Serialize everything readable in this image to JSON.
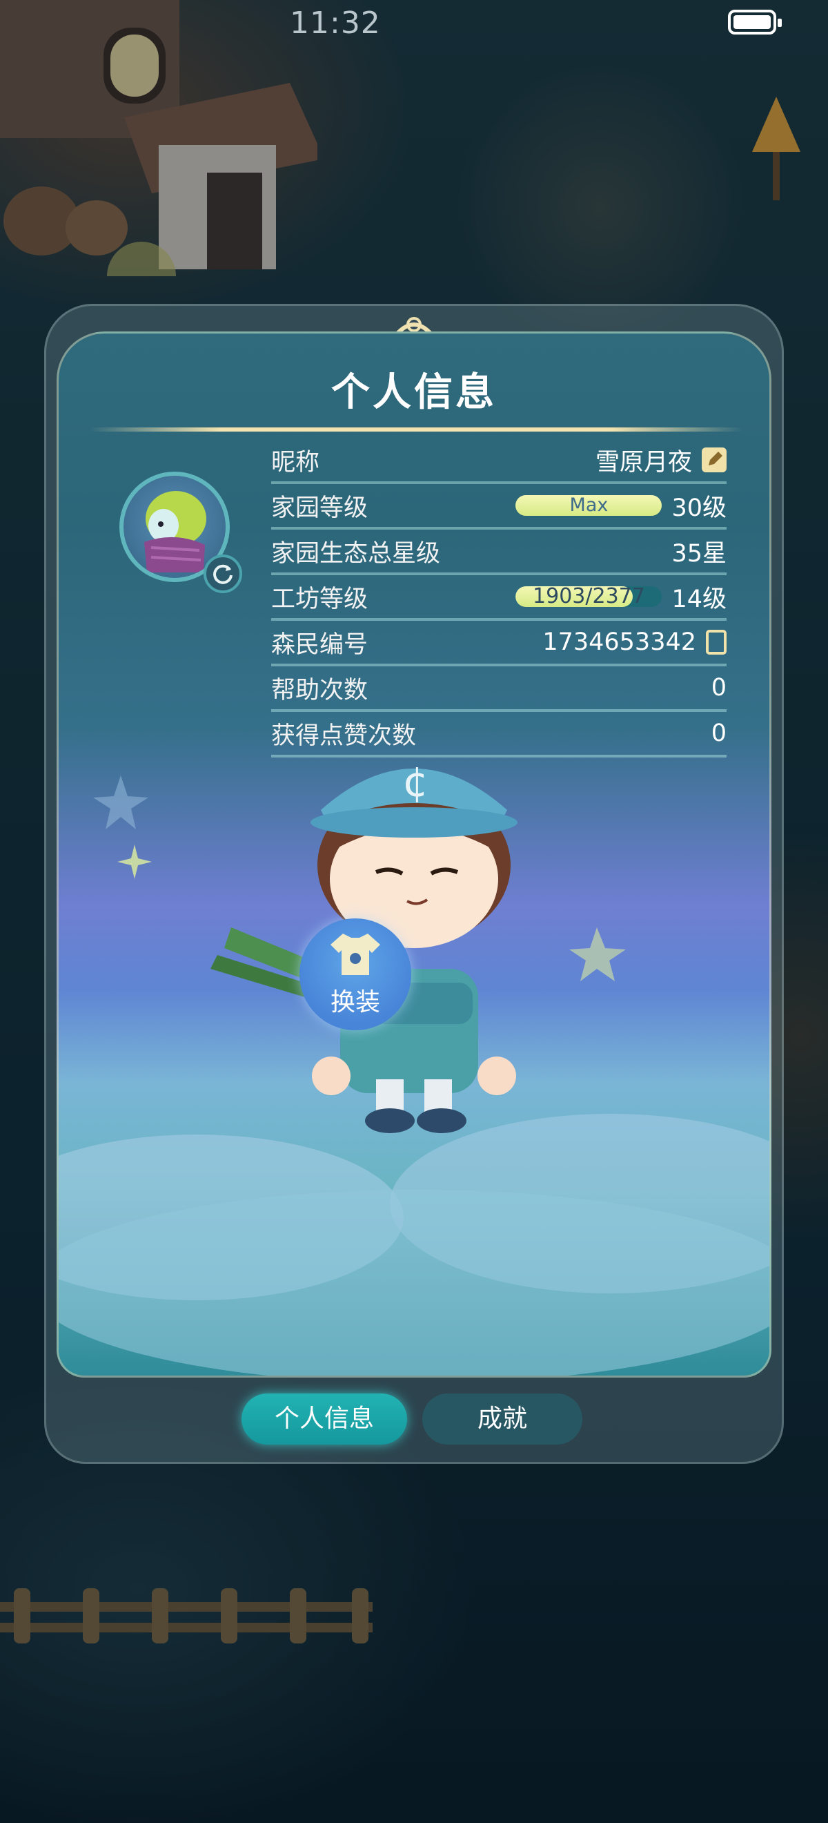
{
  "status_bar": {
    "time": "11:32"
  },
  "panel": {
    "title": "个人信息",
    "rows": [
      {
        "label": "昵称",
        "value": "雪原月夜"
      },
      {
        "label": "家园等级",
        "bar_text": "Max",
        "value": "30级"
      },
      {
        "label": "家园生态总星级",
        "value": "35星"
      },
      {
        "label": "工坊等级",
        "bar_text": "1903/2377",
        "progress": 0.8,
        "value": "14级"
      },
      {
        "label": "森民编号",
        "value": "1734653342"
      },
      {
        "label": "帮助次数",
        "value": "0"
      },
      {
        "label": "获得点赞次数",
        "value": "0"
      }
    ],
    "outfit_button": "换装"
  },
  "tabs": [
    {
      "label": "个人信息",
      "active": true
    },
    {
      "label": "成就",
      "active": false
    }
  ],
  "icons": [
    "edit-icon",
    "copy-icon",
    "refresh-icon",
    "shirt-icon"
  ],
  "colors": {
    "tab_active": "#1aa5a8",
    "bar_fill": "#e3f09b"
  }
}
